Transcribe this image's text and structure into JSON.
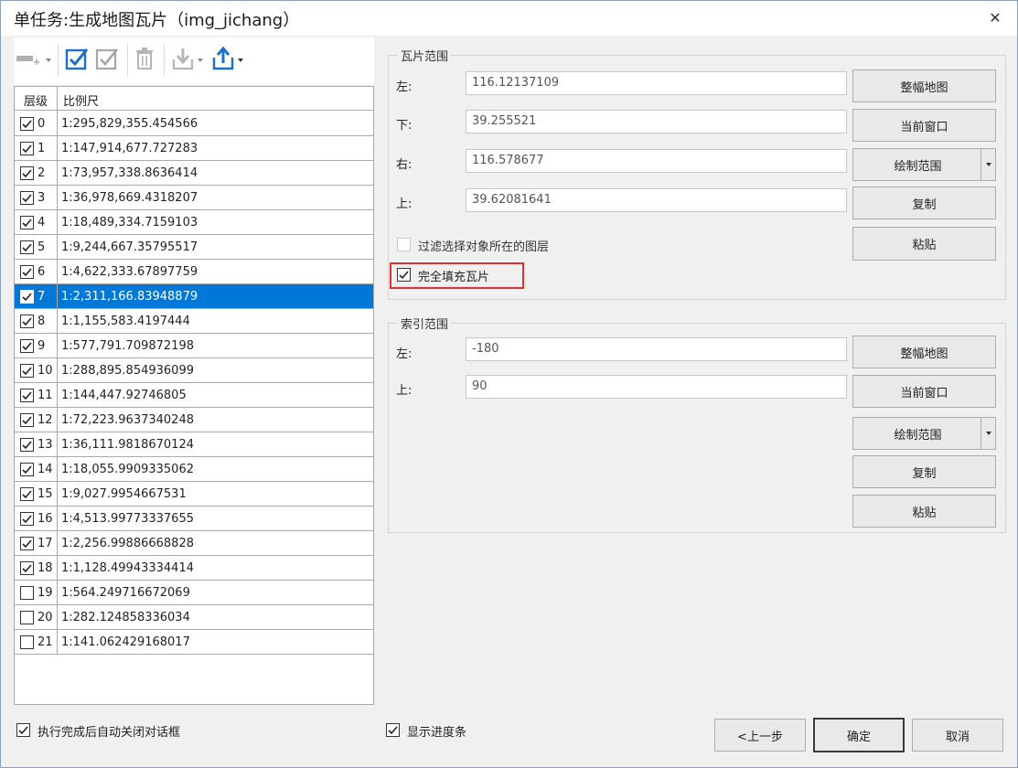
{
  "window": {
    "title": "单任务:生成地图瓦片（img_jichang）",
    "close": "✕"
  },
  "toolbar": {
    "icons": [
      "add-layer-icon",
      "check-all-icon",
      "check-selected-icon",
      "delete-icon",
      "import-icon",
      "export-icon"
    ]
  },
  "table": {
    "headers": {
      "level": "层级",
      "scale": "比例尺"
    },
    "rows": [
      {
        "level": "0",
        "scale": "1:295,829,355.454566",
        "checked": true
      },
      {
        "level": "1",
        "scale": "1:147,914,677.727283",
        "checked": true
      },
      {
        "level": "2",
        "scale": "1:73,957,338.8636414",
        "checked": true
      },
      {
        "level": "3",
        "scale": "1:36,978,669.4318207",
        "checked": true
      },
      {
        "level": "4",
        "scale": "1:18,489,334.7159103",
        "checked": true
      },
      {
        "level": "5",
        "scale": "1:9,244,667.35795517",
        "checked": true
      },
      {
        "level": "6",
        "scale": "1:4,622,333.67897759",
        "checked": true
      },
      {
        "level": "7",
        "scale": "1:2,311,166.83948879",
        "checked": true,
        "selected": true
      },
      {
        "level": "8",
        "scale": "1:1,155,583.4197444",
        "checked": true
      },
      {
        "level": "9",
        "scale": "1:577,791.709872198",
        "checked": true
      },
      {
        "level": "10",
        "scale": "1:288,895.854936099",
        "checked": true
      },
      {
        "level": "11",
        "scale": "1:144,447.92746805",
        "checked": true
      },
      {
        "level": "12",
        "scale": "1:72,223.9637340248",
        "checked": true
      },
      {
        "level": "13",
        "scale": "1:36,111.9818670124",
        "checked": true
      },
      {
        "level": "14",
        "scale": "1:18,055.9909335062",
        "checked": true
      },
      {
        "level": "15",
        "scale": "1:9,027.9954667531",
        "checked": true
      },
      {
        "level": "16",
        "scale": "1:4,513.99773337655",
        "checked": true
      },
      {
        "level": "17",
        "scale": "1:2,256.99886668828",
        "checked": true
      },
      {
        "level": "18",
        "scale": "1:1,128.49943334414",
        "checked": true
      },
      {
        "level": "19",
        "scale": "1:564.249716672069",
        "checked": false
      },
      {
        "level": "20",
        "scale": "1:282.124858336034",
        "checked": false
      },
      {
        "level": "21",
        "scale": "1:141.062429168017",
        "checked": false
      }
    ]
  },
  "tile_range": {
    "label": "瓦片范围",
    "left_label": "左:",
    "left_value": "116.12137109",
    "bottom_label": "下:",
    "bottom_value": "39.255521",
    "right_label": "右:",
    "right_value": "116.578677",
    "top_label": "上:",
    "top_value": "39.62081641",
    "btn_full_map": "整幅地图",
    "btn_current_window": "当前窗口",
    "btn_draw_range": "绘制范围",
    "btn_copy": "复制",
    "btn_paste": "粘贴",
    "filter_label": "过滤选择对象所在的图层",
    "filter_checked": false,
    "fill_label": "完全填充瓦片",
    "fill_checked": true
  },
  "index_range": {
    "label": "索引范围",
    "left_label": "左:",
    "left_value": "-180",
    "top_label": "上:",
    "top_value": "90",
    "btn_full_map": "整幅地图",
    "btn_current_window": "当前窗口",
    "btn_draw_range": "绘制范围",
    "btn_copy": "复制",
    "btn_paste": "粘贴"
  },
  "footer": {
    "auto_close_label": "执行完成后自动关闭对话框",
    "auto_close_checked": true,
    "progress_label": "显示进度条",
    "progress_checked": true,
    "prev": "<上一步",
    "ok": "确定",
    "cancel": "取消"
  },
  "colors": {
    "selection": "#0078d7",
    "highlight_border": "#e03030",
    "accent": "#1e6fc9"
  }
}
